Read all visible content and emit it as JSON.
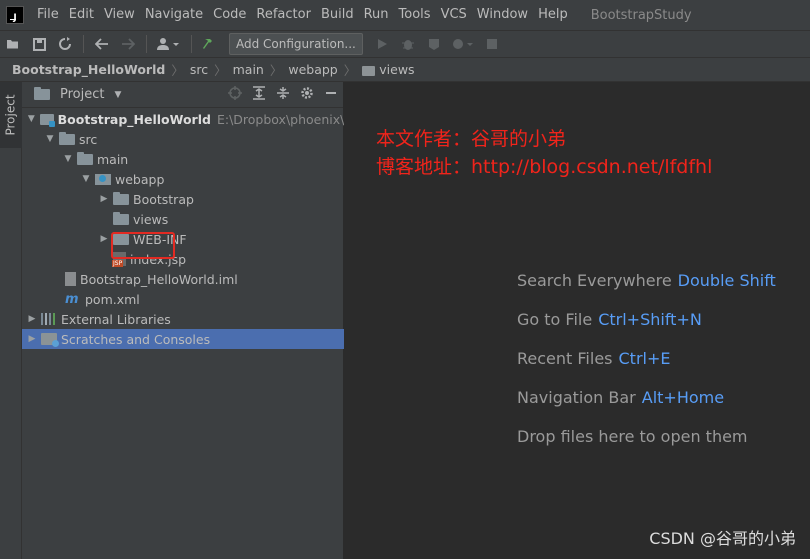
{
  "menubar": {
    "items": [
      "File",
      "Edit",
      "View",
      "Navigate",
      "Code",
      "Refactor",
      "Build",
      "Run",
      "Tools",
      "VCS",
      "Window",
      "Help"
    ],
    "project_name": "BootstrapStudy"
  },
  "toolbar": {
    "add_configuration": "Add Configuration..."
  },
  "breadcrumb": {
    "items": [
      "Bootstrap_HelloWorld",
      "src",
      "main",
      "webapp",
      "views"
    ]
  },
  "stripe": {
    "project_tab": "Project"
  },
  "panel": {
    "title": "Project"
  },
  "tree": {
    "root_label": "Bootstrap_HelloWorld",
    "root_path": "E:\\Dropbox\\phoenix\\fro",
    "src": "src",
    "main": "main",
    "webapp": "webapp",
    "bootstrap": "Bootstrap",
    "views": "views",
    "web_inf": "WEB-INF",
    "index_jsp": "index.jsp",
    "iml": "Bootstrap_HelloWorld.iml",
    "pom": "pom.xml",
    "external_libraries": "External Libraries",
    "scratches": "Scratches and Consoles"
  },
  "editor": {
    "author_line": "本文作者：谷哥的小弟",
    "blog_line": "博客地址：http://blog.csdn.net/lfdfhl",
    "hints": [
      {
        "text": "Search Everywhere",
        "key": "Double Shift"
      },
      {
        "text": "Go to File",
        "key": "Ctrl+Shift+N"
      },
      {
        "text": "Recent Files",
        "key": "Ctrl+E"
      },
      {
        "text": "Navigation Bar",
        "key": "Alt+Home"
      },
      {
        "text": "Drop files here to open them",
        "key": ""
      }
    ],
    "watermark": "CSDN @谷哥的小弟"
  },
  "colors": {
    "background": "#2b2b2b",
    "panel": "#3c3f41",
    "selection": "#4b6eaf",
    "annotation_red": "#f0241b",
    "shortcut_blue": "#589df6"
  }
}
